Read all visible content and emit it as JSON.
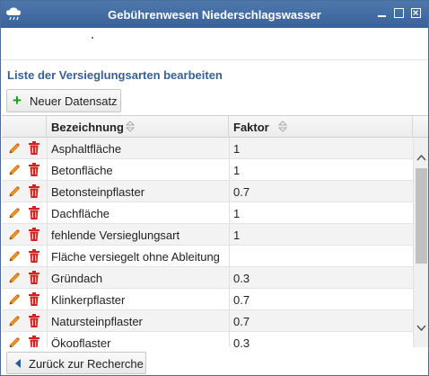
{
  "window": {
    "title": "Gebührenwesen Niederschlagswasser"
  },
  "section": {
    "title": "Liste der Versieglungsarten bearbeiten"
  },
  "toolbar": {
    "new_label": "Neuer Datensatz"
  },
  "grid": {
    "columns": [
      "Bezeichnung",
      "Faktor"
    ],
    "rows": [
      {
        "bezeichnung": "Asphaltfläche",
        "faktor": "1"
      },
      {
        "bezeichnung": "Betonfläche",
        "faktor": "1"
      },
      {
        "bezeichnung": "Betonsteinpflaster",
        "faktor": "0.7"
      },
      {
        "bezeichnung": "Dachfläche",
        "faktor": "1"
      },
      {
        "bezeichnung": "fehlende Versieglungsart",
        "faktor": "1"
      },
      {
        "bezeichnung": "Fläche versiegelt ohne Ableitung",
        "faktor": ""
      },
      {
        "bezeichnung": "Gründach",
        "faktor": "0.3"
      },
      {
        "bezeichnung": "Klinkerpflaster",
        "faktor": "0.7"
      },
      {
        "bezeichnung": "Natursteinpflaster",
        "faktor": "0.7"
      },
      {
        "bezeichnung": "Ökopflaster",
        "faktor": "0.3"
      }
    ]
  },
  "footer": {
    "back_label": "Zurück zur Recherche"
  },
  "icons": {
    "edit": "pencil-icon",
    "delete": "trash-icon",
    "add": "plus-icon",
    "back": "arrow-left-icon",
    "app": "cloud-rain-icon"
  },
  "colors": {
    "titlebar": "#3f6aa1",
    "section_title": "#3a5f96",
    "add_icon": "#1a9a1a",
    "delete_icon": "#d32020",
    "edit_icon": "#f08a00"
  }
}
